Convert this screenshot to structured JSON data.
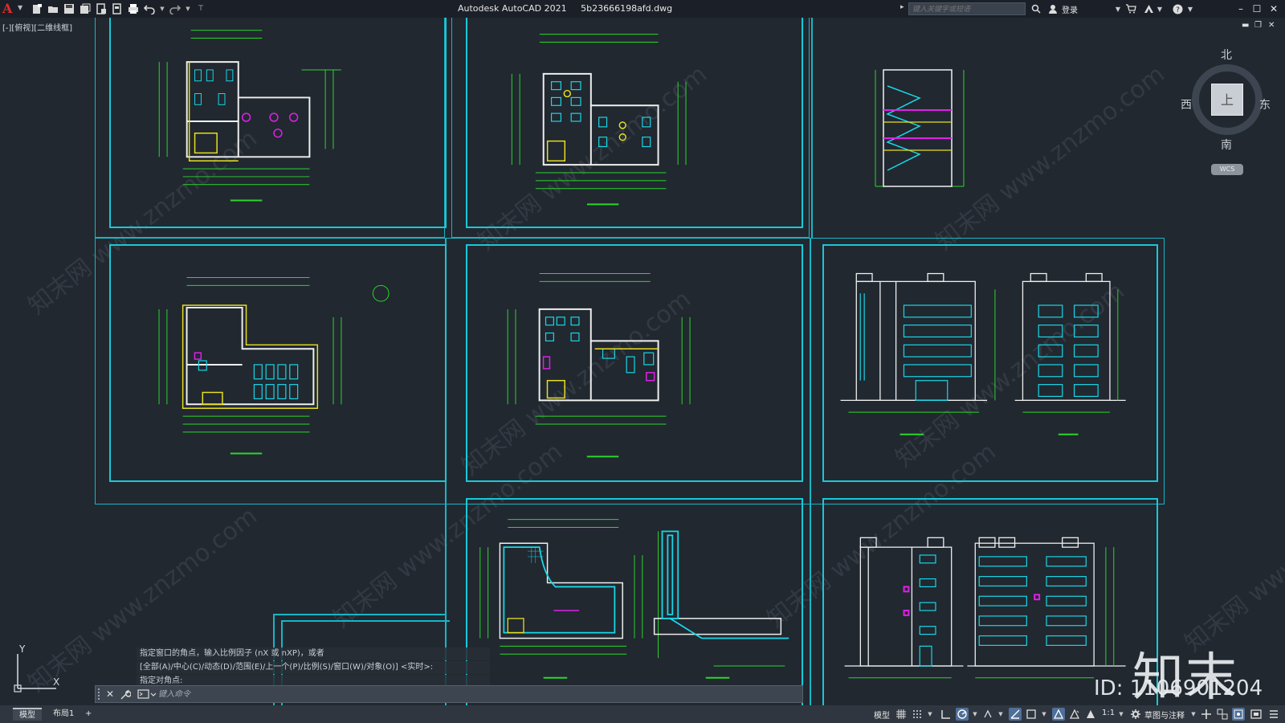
{
  "app": {
    "name": "Autodesk AutoCAD 2021",
    "file": "5b23666198afd.dwg"
  },
  "search": {
    "placeholder": "键入关键字或短语"
  },
  "user": {
    "login_label": "登录"
  },
  "viewport": {
    "label": "[-][俯视][二维线框]"
  },
  "viewcube": {
    "north": "北",
    "south": "南",
    "east": "东",
    "west": "西",
    "face": "上",
    "wcs": "WCS"
  },
  "ucs": {
    "x": "X",
    "y": "Y"
  },
  "command": {
    "history": [
      "指定窗口的角点，输入比例因子 (nX 或 nXP)，或者",
      "[全部(A)/中心(C)/动态(D)/范围(E)/上一个(P)/比例(S)/窗口(W)/对象(O)] <实时>:",
      "指定对角点:"
    ],
    "placeholder": "键入命令"
  },
  "layout_tabs": [
    "模型",
    "布局1"
  ],
  "add_tab": "+",
  "status": {
    "model_label": "模型",
    "scale": "1:1",
    "workspace": "草图与注释"
  },
  "branding": {
    "logo": "知末",
    "id": "ID: 1106901204",
    "watermark": "知末网 www.znzmo.com"
  },
  "colors": {
    "background": "#212830",
    "sheet_border": "#19c8d8",
    "dim": "#2bd62b",
    "wall": "#f0f0f0",
    "cyan": "#19d8e8",
    "yellow": "#e8e020",
    "magenta": "#e020e8"
  }
}
